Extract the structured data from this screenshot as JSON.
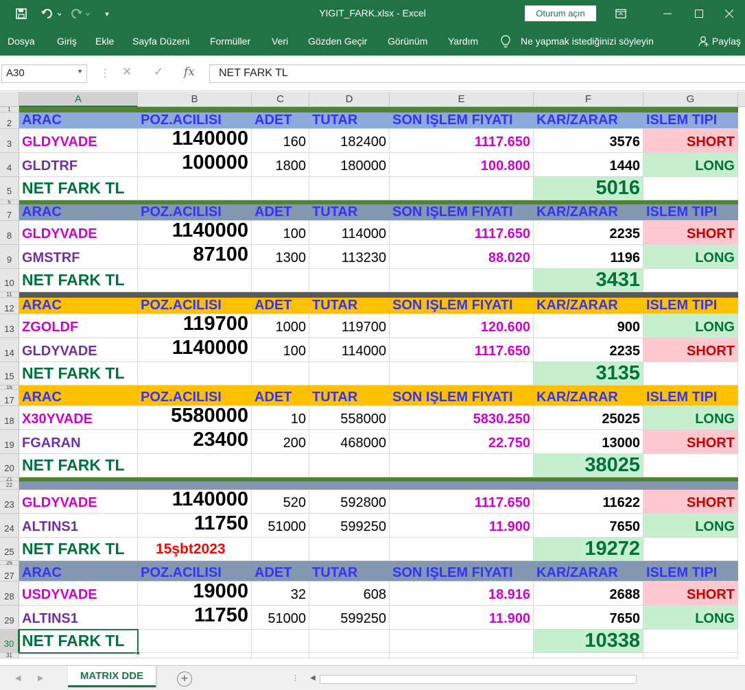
{
  "window": {
    "title": "YIGIT_FARK.xlsx  -  Excel",
    "signin": "Oturum açın"
  },
  "ribbon": {
    "tabs": [
      "Dosya",
      "Giriş",
      "Ekle",
      "Sayfa Düzeni",
      "Formüller",
      "Veri",
      "Gözden Geçir",
      "Görünüm",
      "Yardım"
    ],
    "tell_me": "Ne yapmak istediğinizi söyleyin",
    "share": "Paylaş"
  },
  "formula_bar": {
    "name_box": "A30",
    "formula": "NET FARK TL"
  },
  "columns": [
    "A",
    "B",
    "C",
    "D",
    "E",
    "F",
    "G"
  ],
  "colors": {
    "header_blue": "#8eaadb",
    "header_gray": "#8497b0",
    "header_gold": "#ffc000",
    "band_green": "#548235",
    "band_dark": "#595959",
    "band_slate": "#8497b0",
    "text_blue": "#3333ff",
    "text_magenta": "#cc00cc",
    "text_purple": "#7030a0",
    "text_green": "#00703c",
    "text_red": "#c00000",
    "fill_pink": "#ffc7ce",
    "fill_green": "#c6efce",
    "date_red": "#ff0000"
  },
  "rows": [
    {
      "n": "1",
      "type": "band",
      "color": "band_green"
    },
    {
      "n": "2",
      "type": "header",
      "fill": "header_blue",
      "cells": [
        "ARAC",
        "POZ.ACILISI",
        "ADET",
        "TUTAR",
        "SON IŞLEM FIYATI",
        "KAR/ZARAR",
        "ISLEM TIPI"
      ]
    },
    {
      "n": "3",
      "type": "data",
      "name_color": "text_magenta",
      "cells": [
        "GLDYVADE",
        "1140000",
        "160",
        "182400",
        "1117.650",
        "3576",
        "SHORT"
      ]
    },
    {
      "n": "4",
      "type": "data",
      "name_color": "text_purple",
      "cells": [
        "GLDTRF",
        "100000",
        "1800",
        "180000",
        "100.800",
        "1440",
        "LONG"
      ]
    },
    {
      "n": "5",
      "type": "net",
      "cells": [
        "NET FARK TL",
        "",
        "",
        "",
        "",
        "5016",
        ""
      ]
    },
    {
      "n": "6",
      "type": "band",
      "color": "band_green"
    },
    {
      "n": "7",
      "type": "header",
      "fill": "header_gray",
      "cells": [
        "ARAC",
        "POZ.ACILISI",
        "ADET",
        "TUTAR",
        "SON IŞLEM FIYATI",
        "KAR/ZARAR",
        "ISLEM TIPI"
      ]
    },
    {
      "n": "8",
      "type": "data",
      "name_color": "text_magenta",
      "cells": [
        "GLDYVADE",
        "1140000",
        "100",
        "114000",
        "1117.650",
        "2235",
        "SHORT"
      ]
    },
    {
      "n": "9",
      "type": "data",
      "name_color": "text_purple",
      "cells": [
        "GMSTRF",
        "87100",
        "1300",
        "113230",
        "88.020",
        "1196",
        "LONG"
      ]
    },
    {
      "n": "10",
      "type": "net",
      "cells": [
        "NET FARK TL",
        "",
        "",
        "",
        "",
        "3431",
        ""
      ]
    },
    {
      "n": "11",
      "type": "band",
      "color": "band_dark"
    },
    {
      "n": "12",
      "type": "header",
      "fill": "header_gold",
      "cells": [
        "ARAC",
        "POZ.ACILISI",
        "ADET",
        "TUTAR",
        "SON IŞLEM FIYATI",
        "KAR/ZARAR",
        "ISLEM TIPI"
      ]
    },
    {
      "n": "13",
      "type": "data",
      "name_color": "text_magenta",
      "cells": [
        "ZGOLDF",
        "119700",
        "1000",
        "119700",
        "120.600",
        "900",
        "LONG"
      ]
    },
    {
      "n": "14",
      "type": "data",
      "name_color": "text_purple",
      "cells": [
        "GLDYVADE",
        "1140000",
        "100",
        "114000",
        "1117.650",
        "2235",
        "SHORT"
      ]
    },
    {
      "n": "15",
      "type": "net",
      "cells": [
        "NET FARK TL",
        "",
        "",
        "",
        "",
        "3135",
        ""
      ]
    },
    {
      "n": "16",
      "type": "band",
      "color": "header_gold"
    },
    {
      "n": "17",
      "type": "header",
      "fill": "header_gold",
      "cells": [
        "ARAC",
        "POZ.ACILISI",
        "ADET",
        "TUTAR",
        "SON IŞLEM FIYATI",
        "KAR/ZARAR",
        "ISLEM TIPI"
      ]
    },
    {
      "n": "18",
      "type": "data",
      "name_color": "text_magenta",
      "cells": [
        "X30YVADE",
        "5580000",
        "10",
        "558000",
        "5830.250",
        "25025",
        "LONG"
      ]
    },
    {
      "n": "19",
      "type": "data",
      "name_color": "text_purple",
      "cells": [
        "FGARAN",
        "23400",
        "200",
        "468000",
        "22.750",
        "13000",
        "SHORT"
      ]
    },
    {
      "n": "20",
      "type": "net",
      "cells": [
        "NET FARK TL",
        "",
        "",
        "",
        "",
        "38025",
        ""
      ]
    },
    {
      "n": "21",
      "type": "band",
      "color": "band_green"
    },
    {
      "n": "22",
      "type": "band",
      "color": "band_slate"
    },
    {
      "n": "23",
      "type": "data",
      "name_color": "text_magenta",
      "cells": [
        "GLDYVADE",
        "1140000",
        "520",
        "592800",
        "1117.650",
        "11622",
        "SHORT"
      ]
    },
    {
      "n": "24",
      "type": "data",
      "name_color": "text_purple",
      "cells": [
        "ALTINS1",
        "11750",
        "51000",
        "599250",
        "11.900",
        "7650",
        "LONG"
      ]
    },
    {
      "n": "25",
      "type": "net",
      "cells": [
        "NET FARK TL",
        "15şbt2023",
        "",
        "",
        "",
        "19272",
        ""
      ]
    },
    {
      "n": "26",
      "type": "band",
      "color": "band_slate"
    },
    {
      "n": "27",
      "type": "header",
      "fill": "header_gray",
      "cells": [
        "ARAC",
        "POZ.ACILISI",
        "ADET",
        "TUTAR",
        "SON IŞLEM FIYATI",
        "KAR/ZARAR",
        "ISLEM TIPI"
      ]
    },
    {
      "n": "28",
      "type": "data",
      "name_color": "text_magenta",
      "cells": [
        "USDYVADE",
        "19000",
        "32",
        "608",
        "18.916",
        "2688",
        "SHORT"
      ]
    },
    {
      "n": "29",
      "type": "data",
      "name_color": "text_purple",
      "cells": [
        "ALTINS1",
        "11750",
        "51000",
        "599250",
        "11.900",
        "7650",
        "LONG"
      ]
    },
    {
      "n": "30",
      "type": "net",
      "cells": [
        "NET FARK TL",
        "",
        "",
        "",
        "",
        "10338",
        ""
      ]
    },
    {
      "n": "31",
      "type": "empty"
    }
  ],
  "sheet": {
    "active_tab": "MATRIX DDE"
  }
}
